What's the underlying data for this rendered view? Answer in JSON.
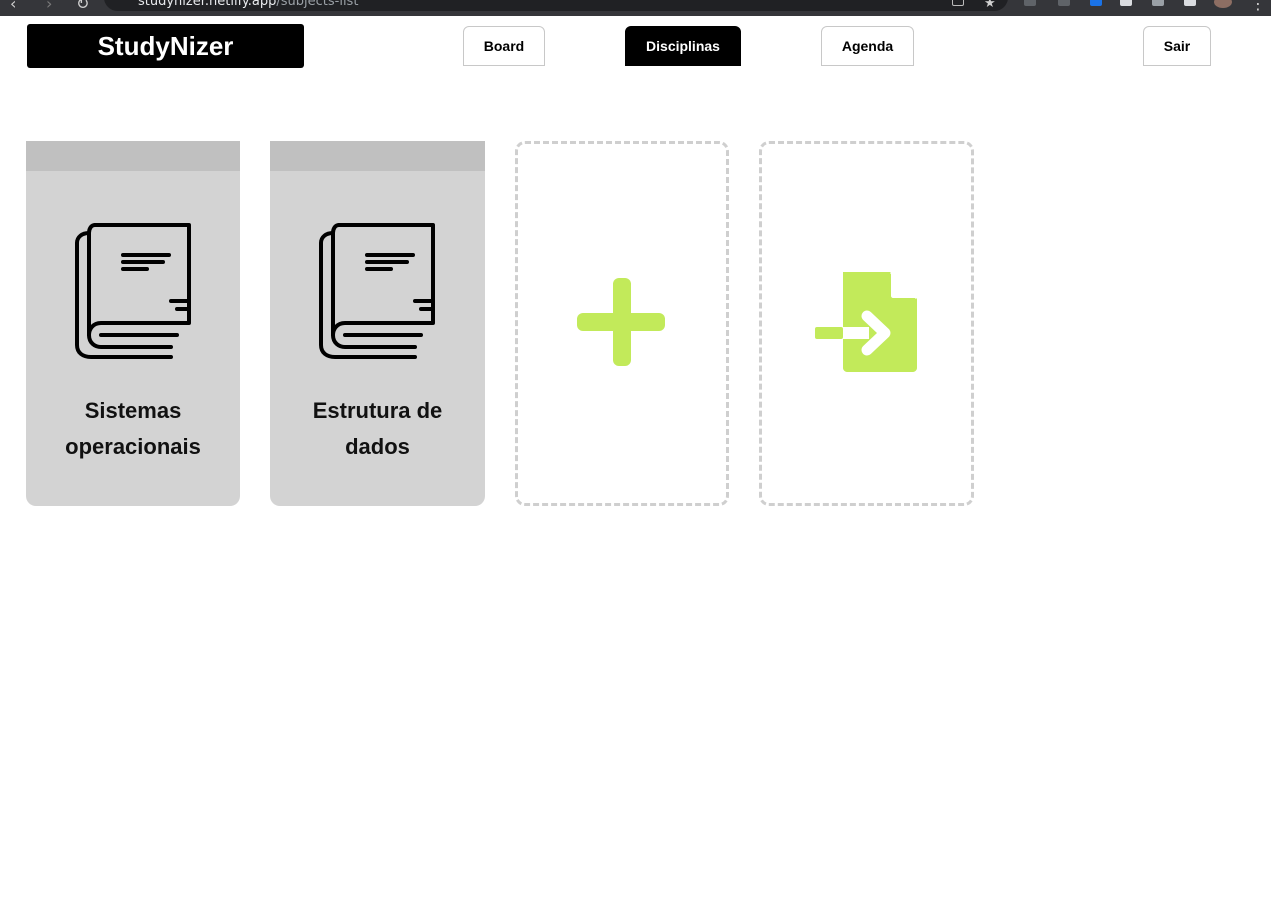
{
  "browser": {
    "url_host": "studynizer.netlify.app",
    "url_path": "/subjects-list",
    "back_glyph": "‹",
    "forward_glyph": "›",
    "reload_glyph": "↻",
    "menu_glyph": "⋮"
  },
  "header": {
    "logo": "StudyNizer",
    "nav": {
      "board": "Board",
      "disciplinas": "Disciplinas",
      "agenda": "Agenda",
      "sair": "Sair"
    },
    "active_tab": "Disciplinas"
  },
  "subjects": [
    {
      "name": "Sistemas operacionais",
      "icon": "book-icon"
    },
    {
      "name": "Estrutura de dados",
      "icon": "book-icon"
    }
  ],
  "actions": {
    "add_icon": "plus-icon",
    "import_icon": "file-import-icon"
  },
  "colors": {
    "accent_green": "#c2ea5a",
    "card_gray": "#d3d3d3",
    "card_top_gray": "#c0c0c0",
    "active_tab_bg": "#000000"
  }
}
